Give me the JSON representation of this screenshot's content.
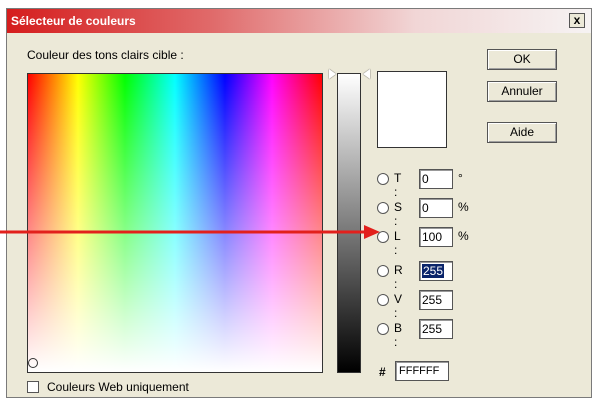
{
  "window": {
    "title": "Sélecteur de couleurs",
    "close_label": "x"
  },
  "caption": "Couleur des tons clairs cible :",
  "buttons": {
    "ok": "OK",
    "cancel": "Annuler",
    "help": "Aide"
  },
  "fields": [
    {
      "label": "T :",
      "value": "0",
      "unit": "°"
    },
    {
      "label": "S :",
      "value": "0",
      "unit": "%"
    },
    {
      "label": "L :",
      "value": "100",
      "unit": "%"
    },
    {
      "label": "R :",
      "value": "255",
      "unit": ""
    },
    {
      "label": "V :",
      "value": "255",
      "unit": ""
    },
    {
      "label": "B :",
      "value": "255",
      "unit": ""
    }
  ],
  "hex": {
    "label": "#",
    "value": "FFFFFF"
  },
  "websafe": {
    "label": "Couleurs Web uniquement",
    "checked": false
  },
  "preview_color": "#FFFFFF",
  "annotation_arrow_color": "#E2201C",
  "icons": {
    "close": "close-icon",
    "radio": "radio-button",
    "checkbox": "checkbox"
  }
}
